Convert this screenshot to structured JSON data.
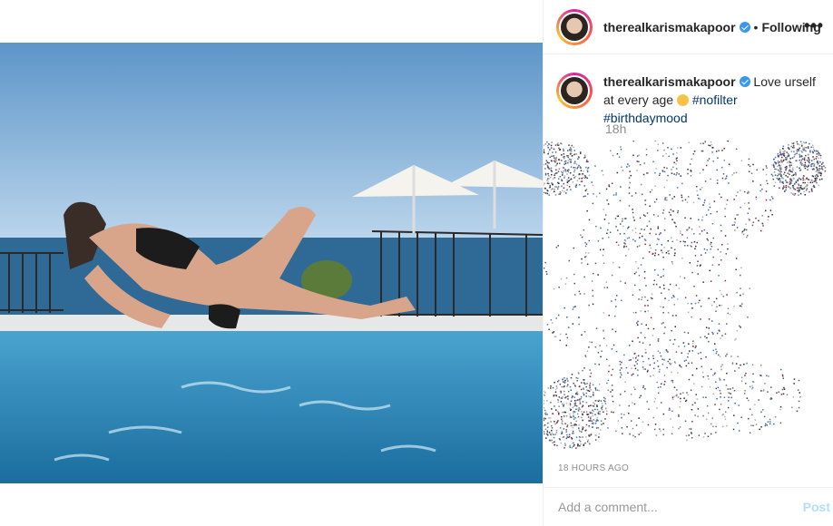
{
  "header": {
    "username": "therealkarismakapoor",
    "separator": "•",
    "follow_status": "Following",
    "more_label": "•••"
  },
  "caption": {
    "username": "therealkarismakapoor",
    "text_before": "Love urself at every age",
    "hashtags": [
      "#nofilter",
      "#birthdaymood"
    ],
    "relative_time": "18h"
  },
  "post": {
    "timestamp": "18 HOURS AGO"
  },
  "comment_bar": {
    "placeholder": "Add a comment...",
    "post_label": "Post"
  },
  "colors": {
    "accent_blue": "#3897f0",
    "hashtag": "#00376b",
    "muted": "#8e8e8e"
  },
  "icons": [
    "verified-badge-icon",
    "more-options-icon",
    "smile-emoji-icon"
  ]
}
